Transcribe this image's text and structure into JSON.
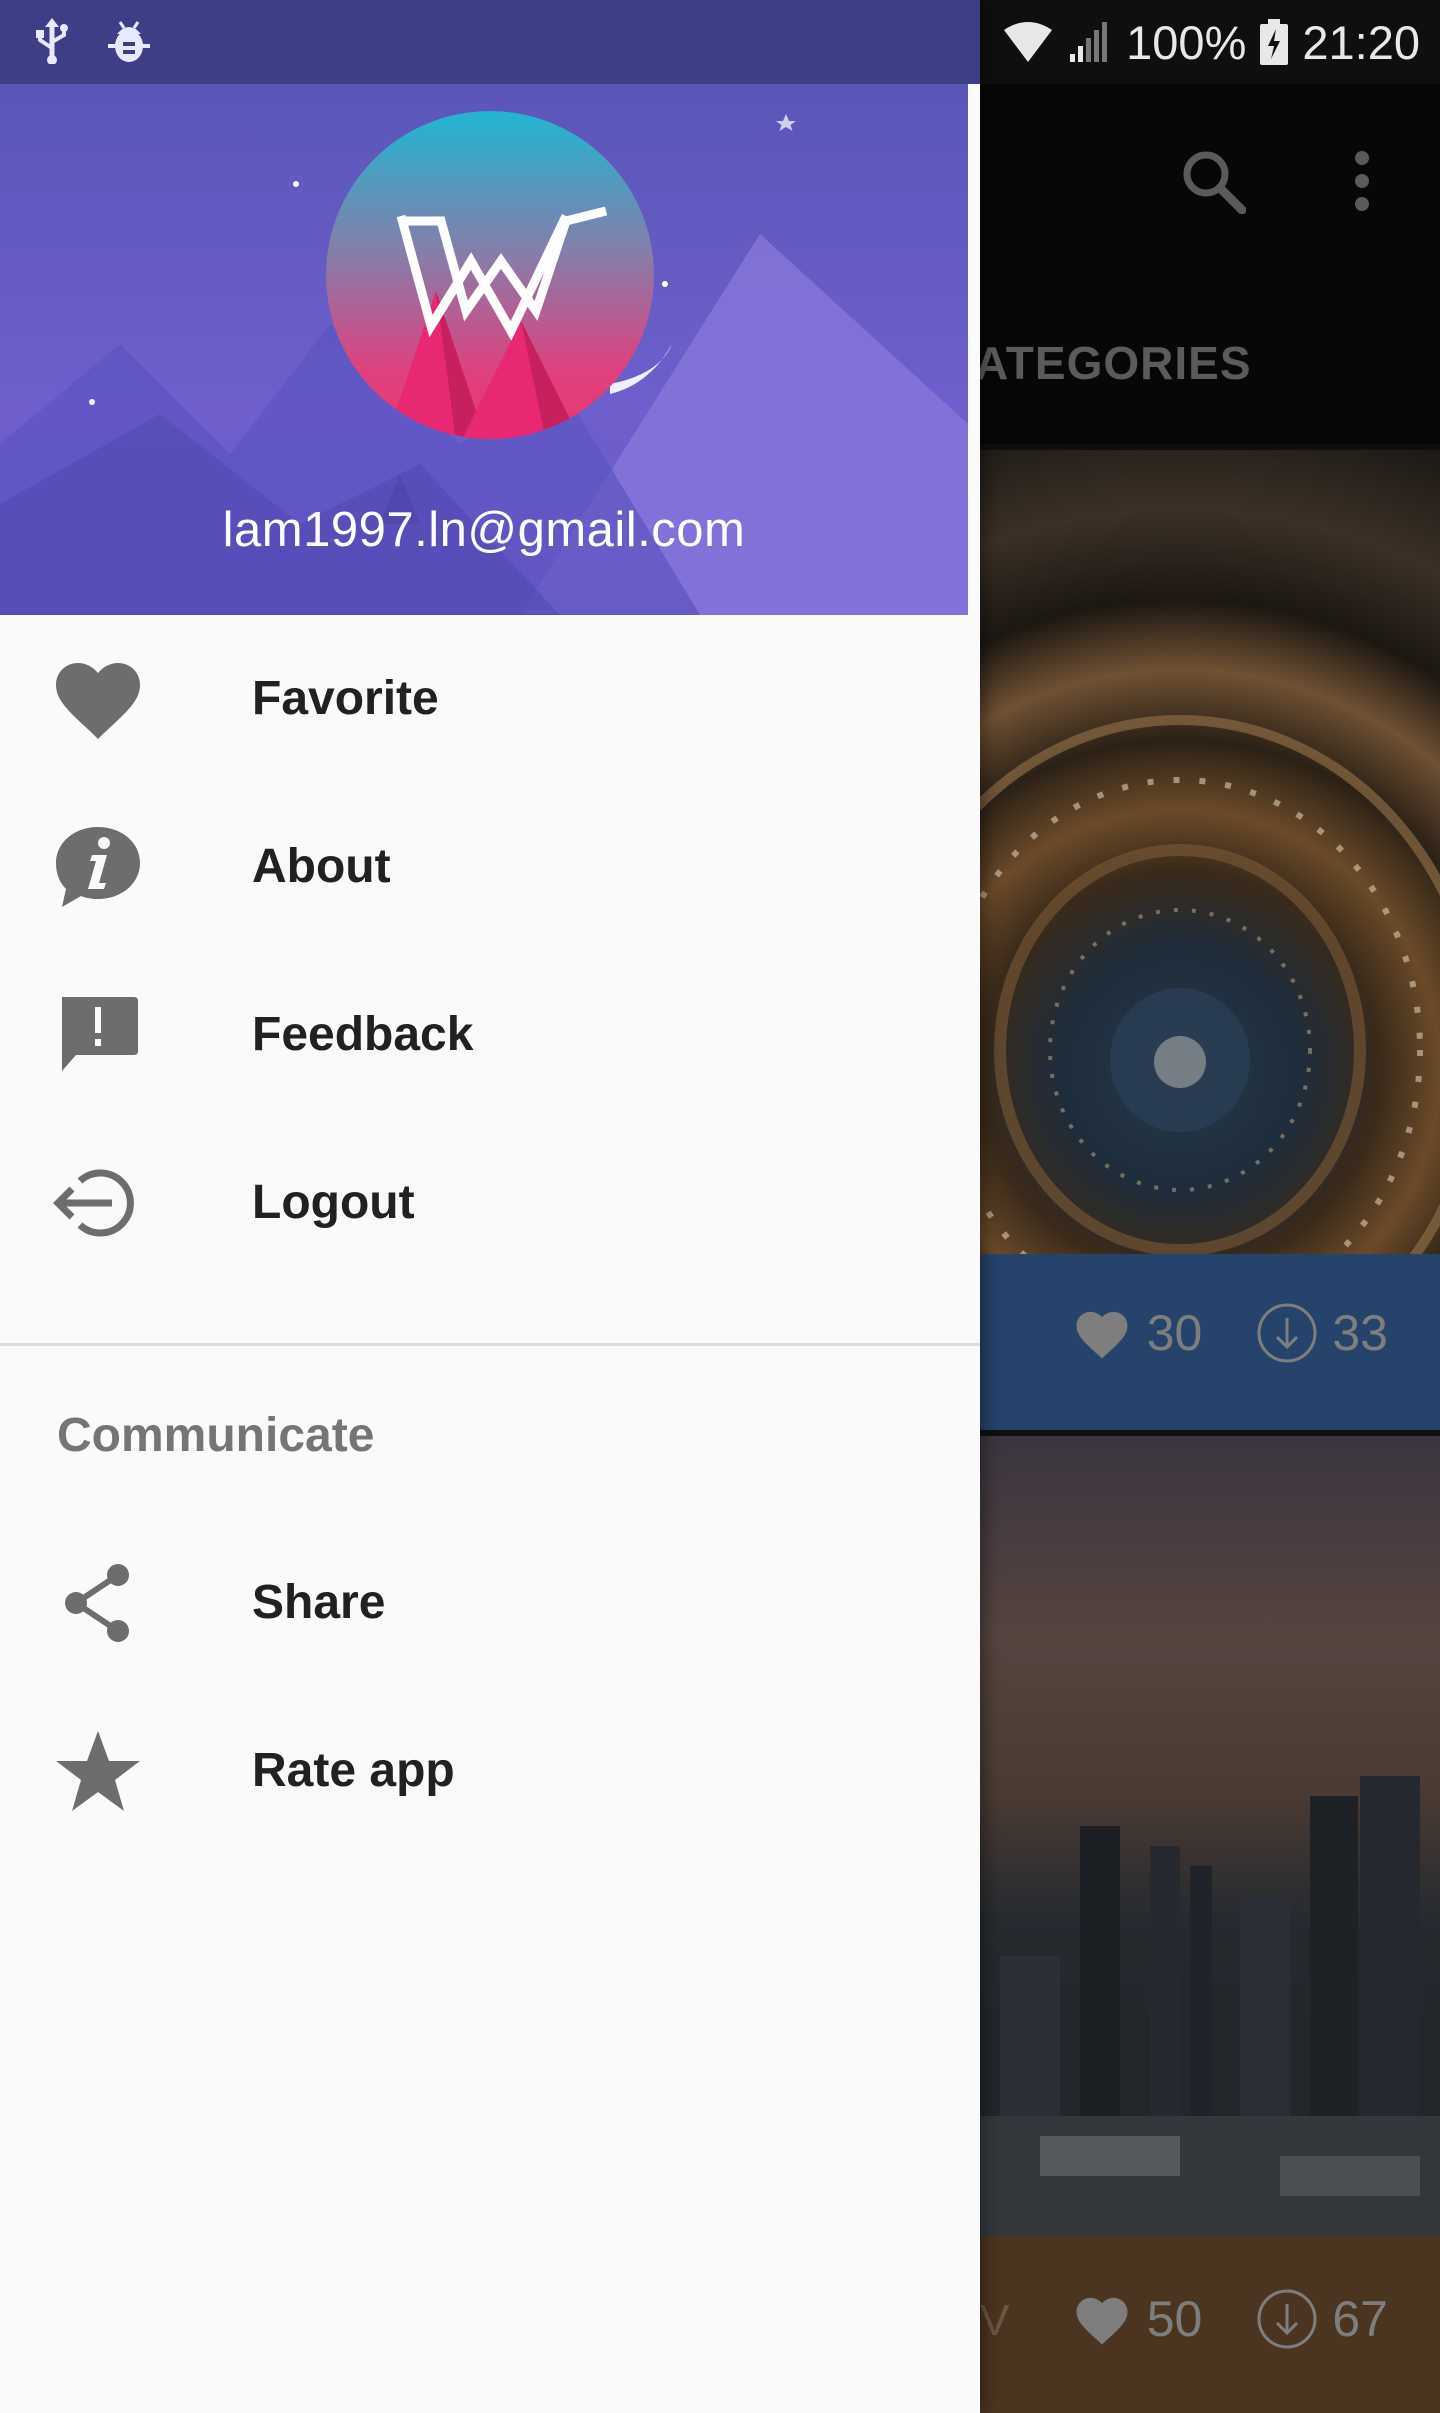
{
  "status_bar": {
    "battery": "100%",
    "time": "21:20"
  },
  "background_app": {
    "tab_fragment": "ATEGORIES",
    "card1": {
      "likes": "30",
      "downloads": "33"
    },
    "card2": {
      "partial_text": "V",
      "likes": "50",
      "downloads": "67"
    }
  },
  "drawer": {
    "header": {
      "email": "lam1997.ln@gmail.com"
    },
    "menu": [
      {
        "label": "Favorite",
        "icon": "heart-icon"
      },
      {
        "label": "About",
        "icon": "info-bubble-icon"
      },
      {
        "label": "Feedback",
        "icon": "feedback-icon"
      },
      {
        "label": "Logout",
        "icon": "logout-icon"
      }
    ],
    "section_title": "Communicate",
    "communicate": [
      {
        "label": "Share",
        "icon": "share-icon"
      },
      {
        "label": "Rate app",
        "icon": "star-icon"
      }
    ]
  },
  "colors": {
    "header_purple": "#6a5ccd",
    "statusbar_left": "#3c3f86",
    "drawer_bg": "#fafafa",
    "icon_grey": "#6d6d6d",
    "text_dark": "#212121",
    "section_grey": "#757575"
  }
}
